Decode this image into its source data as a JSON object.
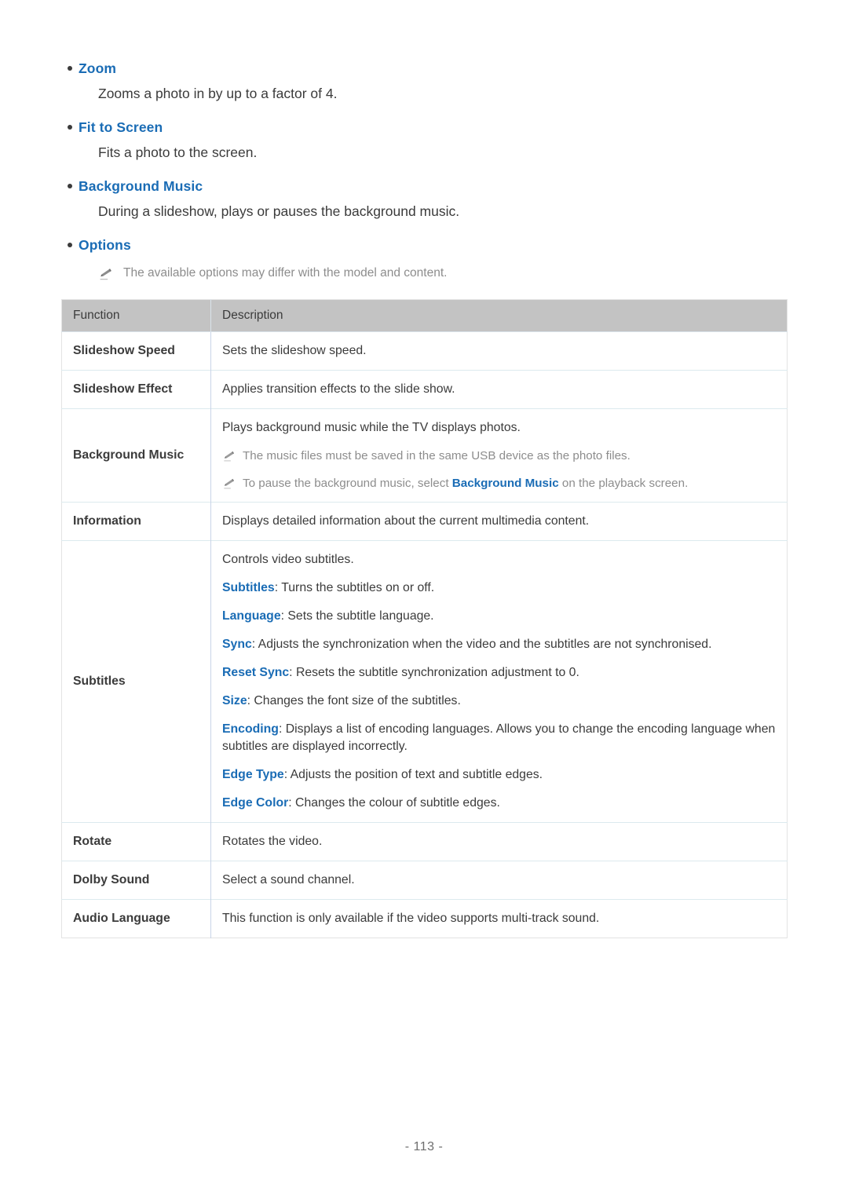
{
  "page": {
    "number_label": "- 113 -",
    "accent_color": "#1a6cb5",
    "body_color": "#3b3b3b",
    "note_color": "#8d8d8d",
    "table_header_bg": "#c3c3c3"
  },
  "bullets": [
    {
      "title": "Zoom",
      "description": "Zooms a photo in by up to a factor of 4."
    },
    {
      "title": "Fit to Screen",
      "description": "Fits a photo to the screen."
    },
    {
      "title": "Background Music",
      "description": "During a slideshow, plays or pauses the background music."
    },
    {
      "title": "Options",
      "note": "The available options may differ with the model and content."
    }
  ],
  "table": {
    "headers": [
      "Function",
      "Description"
    ],
    "rows": [
      {
        "function": "Slideshow Speed",
        "lines": [
          "Sets the slideshow speed."
        ]
      },
      {
        "function": "Slideshow Effect",
        "lines": [
          "Applies transition effects to the slide show."
        ]
      },
      {
        "function": "Background Music",
        "lines": [
          "Plays background music while the TV displays photos."
        ],
        "notes": [
          {
            "pre": "The music files must be saved in the same USB device as the photo files."
          },
          {
            "pre": "To pause the background music, select ",
            "highlight": "Background Music",
            "post": " on the playback screen."
          }
        ]
      },
      {
        "function": "Information",
        "lines": [
          "Displays detailed information about the current multimedia content."
        ]
      },
      {
        "function": "Subtitles",
        "lines": [
          "Controls video subtitles."
        ],
        "terms": [
          {
            "term": "Subtitles",
            "text": ": Turns the subtitles on or off."
          },
          {
            "term": "Language",
            "text": ": Sets the subtitle language."
          },
          {
            "term": "Sync",
            "text": ": Adjusts the synchronization when the video and the subtitles are not synchronised."
          },
          {
            "term": "Reset Sync",
            "text": ": Resets the subtitle synchronization adjustment to 0."
          },
          {
            "term": "Size",
            "text": ": Changes the font size of the subtitles."
          },
          {
            "term": "Encoding",
            "text": ": Displays a list of encoding languages. Allows you to change the encoding language when subtitles are displayed incorrectly."
          },
          {
            "term": "Edge Type",
            "text": ": Adjusts the position of text and subtitle edges."
          },
          {
            "term": "Edge Color",
            "text": ": Changes the colour of subtitle edges."
          }
        ]
      },
      {
        "function": "Rotate",
        "lines": [
          "Rotates the video."
        ]
      },
      {
        "function": "Dolby Sound",
        "lines": [
          "Select a sound channel."
        ]
      },
      {
        "function": "Audio Language",
        "lines": [
          "This function is only available if the video supports multi-track sound."
        ]
      }
    ]
  }
}
